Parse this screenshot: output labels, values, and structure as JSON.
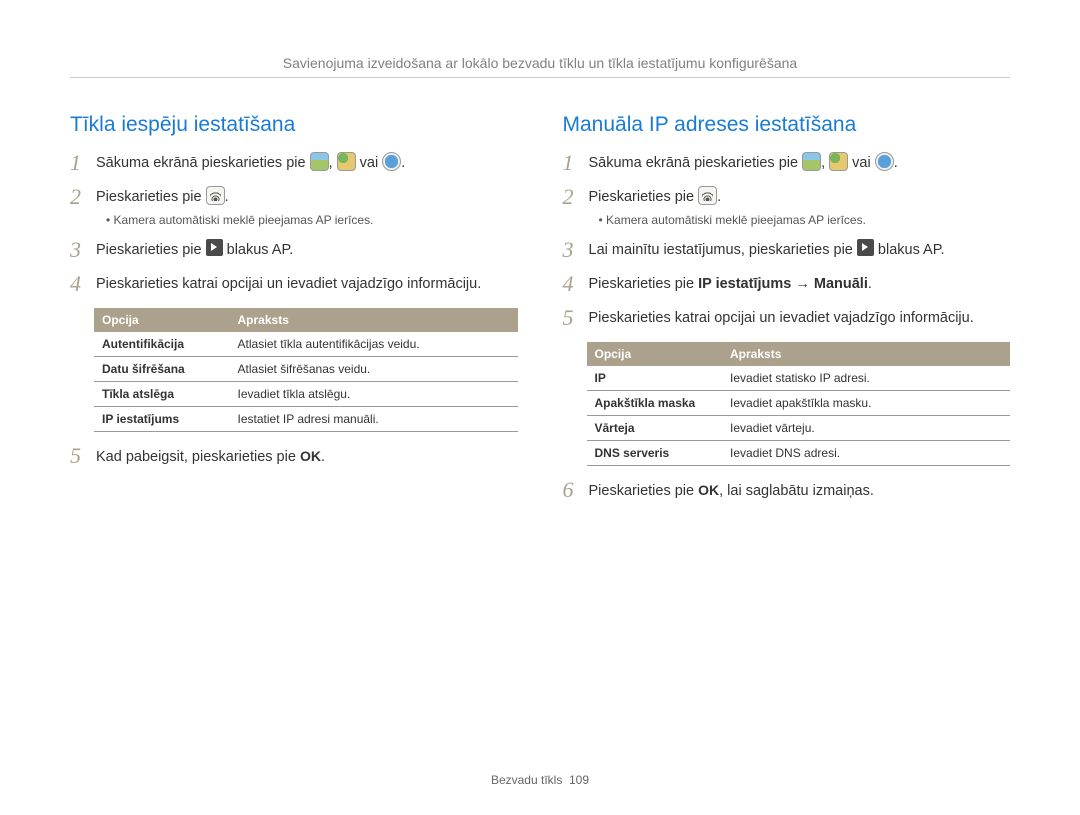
{
  "header": "Savienojuma izveidošana ar lokālo bezvadu tīklu un tīkla iestatījumu konfigurēšana",
  "left": {
    "title": "Tīkla iespēju iestatīšana",
    "s1a": "Sākuma ekrānā pieskarieties pie ",
    "s1b": ", ",
    "s1c": " vai ",
    "s1d": ".",
    "s2a": "Pieskarieties pie ",
    "s2b": ".",
    "s2bullet": "Kamera automātiski meklē pieejamas AP ierīces.",
    "s3a": "Pieskarieties pie ",
    "s3b": " blakus AP.",
    "s4": "Pieskarieties katrai opcijai un ievadiet vajadzīgo informāciju.",
    "table": {
      "h1": "Opcija",
      "h2": "Apraksts",
      "rows": [
        {
          "o": "Autentifikācija",
          "d": "Atlasiet tīkla autentifikācijas veidu."
        },
        {
          "o": "Datu šifrēšana",
          "d": "Atlasiet šifrēšanas veidu."
        },
        {
          "o": "Tīkla atslēga",
          "d": "Ievadiet tīkla atslēgu."
        },
        {
          "o": "IP iestatījums",
          "d": "Iestatiet IP adresi manuāli."
        }
      ]
    },
    "s5a": "Kad pabeigsit, pieskarieties pie ",
    "s5b": "."
  },
  "right": {
    "title": "Manuāla IP adreses iestatīšana",
    "s1a": "Sākuma ekrānā pieskarieties pie ",
    "s1b": ", ",
    "s1c": " vai ",
    "s1d": ".",
    "s2a": "Pieskarieties pie ",
    "s2b": ".",
    "s2bullet": "Kamera automātiski meklē pieejamas AP ierīces.",
    "s3a": "Lai mainītu iestatījumus, pieskarieties pie ",
    "s3b": " blakus AP.",
    "s4a": "Pieskarieties pie ",
    "s4b": "IP iestatījums",
    "s4c": " → ",
    "s4d": "Manuāli",
    "s4e": ".",
    "s5": "Pieskarieties katrai opcijai un ievadiet vajadzīgo informāciju.",
    "table": {
      "h1": "Opcija",
      "h2": "Apraksts",
      "rows": [
        {
          "o": "IP",
          "d": "Ievadiet statisko IP adresi."
        },
        {
          "o": "Apakštīkla maska",
          "d": "Ievadiet apakštīkla masku."
        },
        {
          "o": "Vārteja",
          "d": "Ievadiet vārteju."
        },
        {
          "o": "DNS serveris",
          "d": "Ievadiet DNS adresi."
        }
      ]
    },
    "s6a": "Pieskarieties pie ",
    "s6b": ", lai saglabātu izmaiņas."
  },
  "footer": {
    "section": "Bezvadu tīkls",
    "page": "109"
  },
  "ok": "OK"
}
